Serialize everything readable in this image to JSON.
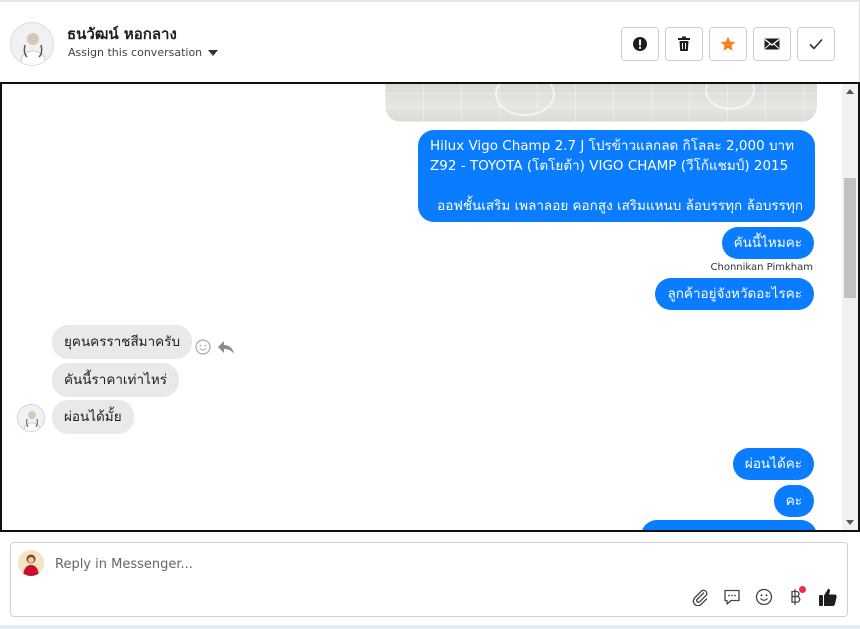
{
  "header": {
    "contact_name": "ธนวัฒน์ หอกลาง",
    "assign_label": "Assign this conversation",
    "actions": [
      {
        "name": "spam-button",
        "icon": "alert-circle-icon"
      },
      {
        "name": "delete-button",
        "icon": "trash-icon"
      },
      {
        "name": "star-button",
        "icon": "star-icon"
      },
      {
        "name": "mark-unread-button",
        "icon": "envelope-icon"
      },
      {
        "name": "done-button",
        "icon": "check-icon"
      }
    ]
  },
  "conversation": {
    "messages": [
      {
        "from": "page",
        "lines": [
          "Hilux Vigo Champ 2.7 J โปรข้าวแลกลด กิโลละ 2,000 บาท",
          "Z92 - TOYOTA (โตโยต้า) VIGO CHAMP (วีโก้แชมป์) 2015",
          "",
          "ออฟชั้นเสริม เพลาลอย คอกสูง เสริมแหนบ ล้อบรรทุก ล้อบรรทุก"
        ]
      },
      {
        "from": "page",
        "text": "คันนี้ไหมคะ"
      },
      {
        "from": "page",
        "sender": "Chonnikan Pimkham",
        "text": "ลูกค้าอยู่จังหวัดอะไรคะ"
      },
      {
        "from": "customer",
        "text": "ยุคนครราชสีมาครับ"
      },
      {
        "from": "customer",
        "text": "คันนี้ราคาเท่าไหร่"
      },
      {
        "from": "customer",
        "text": "ผ่อนได้มั้ย"
      },
      {
        "from": "page",
        "text": "ผ่อนได้คะ"
      },
      {
        "from": "page",
        "text": "คะ"
      }
    ]
  },
  "composer": {
    "placeholder": "Reply in Messenger...",
    "tools": [
      "paperclip-icon",
      "saved-reply-icon",
      "emoji-icon",
      "baht-payment-icon",
      "thumbs-up-icon"
    ]
  },
  "colors": {
    "outgoing_bubble": "#0a7cff",
    "incoming_bubble": "#e9e9eb",
    "star_accent": "#f5821f",
    "notification_dot": "#f02849"
  }
}
